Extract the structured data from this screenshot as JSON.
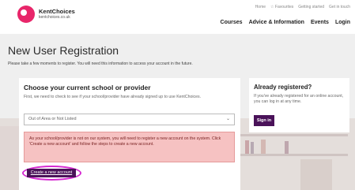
{
  "logo": {
    "title": "KentChoices",
    "subtitle": "kentchoices.co.uk"
  },
  "util_nav": [
    "Home",
    "☆ Favourites",
    "Getting started",
    "Get in touch"
  ],
  "main_nav": [
    "Courses",
    "Advice & Information",
    "Events",
    "Login"
  ],
  "page": {
    "title": "New User Registration",
    "intro": "Please take a few moments to register. You will need this information to access your account in the future."
  },
  "school_card": {
    "heading": "Choose your current school or provider",
    "description": "First, we need to check to see if your school/provider have already signed up to use KentChoices.",
    "select_value": "Out of Area or Not Listed",
    "alert": "As your school/provider is not on our system, you will need to register a new account on the system. Click 'Create a new account' and follow the steps to create a new account.",
    "create_label": "Create a new account"
  },
  "registered_card": {
    "heading": "Already registered?",
    "description": "If you've already registered for an online account, you can log in at any time.",
    "signin_label": "Sign in"
  },
  "colors": {
    "brand_pink": "#e8266a",
    "button_purple": "#4a1259",
    "alert_bg": "#f6c2c2",
    "highlight": "#d52ad1"
  }
}
